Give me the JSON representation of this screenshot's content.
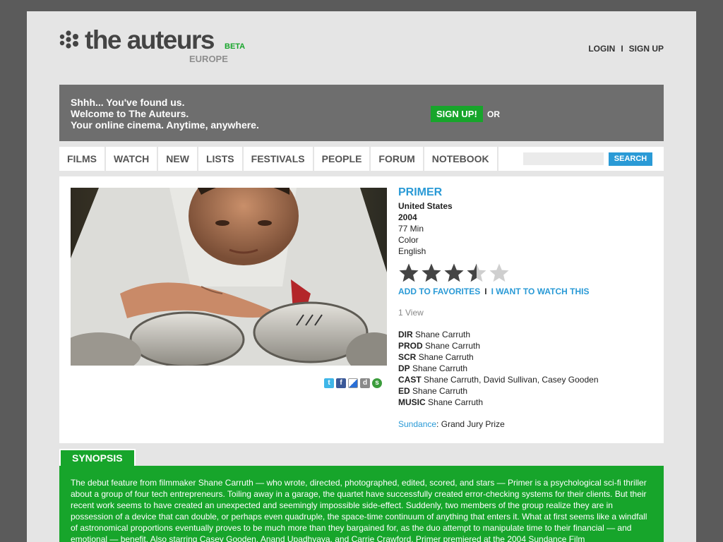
{
  "brand": {
    "name": "the auteurs",
    "badge": "BETA",
    "region": "EUROPE",
    "dark_color": "#444444",
    "green": "#17a52b",
    "blue": "#2a9ad6"
  },
  "auth": {
    "login": "LOGIN",
    "separator": "I",
    "signup": "SIGN UP"
  },
  "promo": {
    "lines": [
      "Shhh... You've found us.",
      "Welcome to The Auteurs.",
      "Your online cinema. Anytime, anywhere."
    ],
    "button": "SIGN UP!",
    "or": "OR"
  },
  "nav": {
    "items": [
      "FILMS",
      "WATCH",
      "NEW",
      "LISTS",
      "FESTIVALS",
      "PEOPLE",
      "FORUM",
      "NOTEBOOK"
    ],
    "search_placeholder": "",
    "search_button": "SEARCH"
  },
  "film": {
    "title": "PRIMER",
    "country": "United States",
    "year": "2004",
    "runtime": "77 Min",
    "color": "Color",
    "language": "English",
    "rating": 3.5,
    "rating_max": 5,
    "add_favorites": "ADD TO FAVORITES",
    "action_sep": "I",
    "watch_this": "I WANT TO WATCH THIS",
    "views": "1 View",
    "credits": [
      {
        "role": "DIR",
        "names": "Shane Carruth"
      },
      {
        "role": "PROD",
        "names": "Shane Carruth"
      },
      {
        "role": "SCR",
        "names": "Shane Carruth"
      },
      {
        "role": "DP",
        "names": "Shane Carruth"
      },
      {
        "role": "CAST",
        "names": "Shane Carruth, David Sullivan, Casey Gooden"
      },
      {
        "role": "ED",
        "names": "Shane Carruth"
      },
      {
        "role": "MUSIC",
        "names": "Shane Carruth"
      }
    ],
    "award_festival": "Sundance",
    "award_sep": ":",
    "award_prize": "Grand Jury Prize",
    "share_icons": [
      "twitter-icon",
      "facebook-icon",
      "delicious-icon",
      "digg-icon",
      "stumbleupon-icon"
    ]
  },
  "synopsis": {
    "heading": "SYNOPSIS",
    "text": "The debut feature from filmmaker Shane Carruth — who wrote, directed, photographed, edited, scored, and stars — Primer is a psychological sci-fi thriller about a group of four tech entrepreneurs. Toiling away in a garage, the quartet have successfully created error-checking systems for their clients. But their recent work seems to have created an unexpected and seemingly impossible side-effect. Suddenly, two members of the group realize they are in possession of a device that can double, or perhaps even quadruple, the space-time continuum of anything that enters it. What at first seems like a windfall of astronomical proportions eventually proves to be much more than they bargained for, as the duo attempt to manipulate time to their financial — and emotional — benefit. Also starring Casey Gooden, Anand Upadhyaya, and Carrie Crawford, Primer premiered at the 2004 Sundance Film"
  }
}
